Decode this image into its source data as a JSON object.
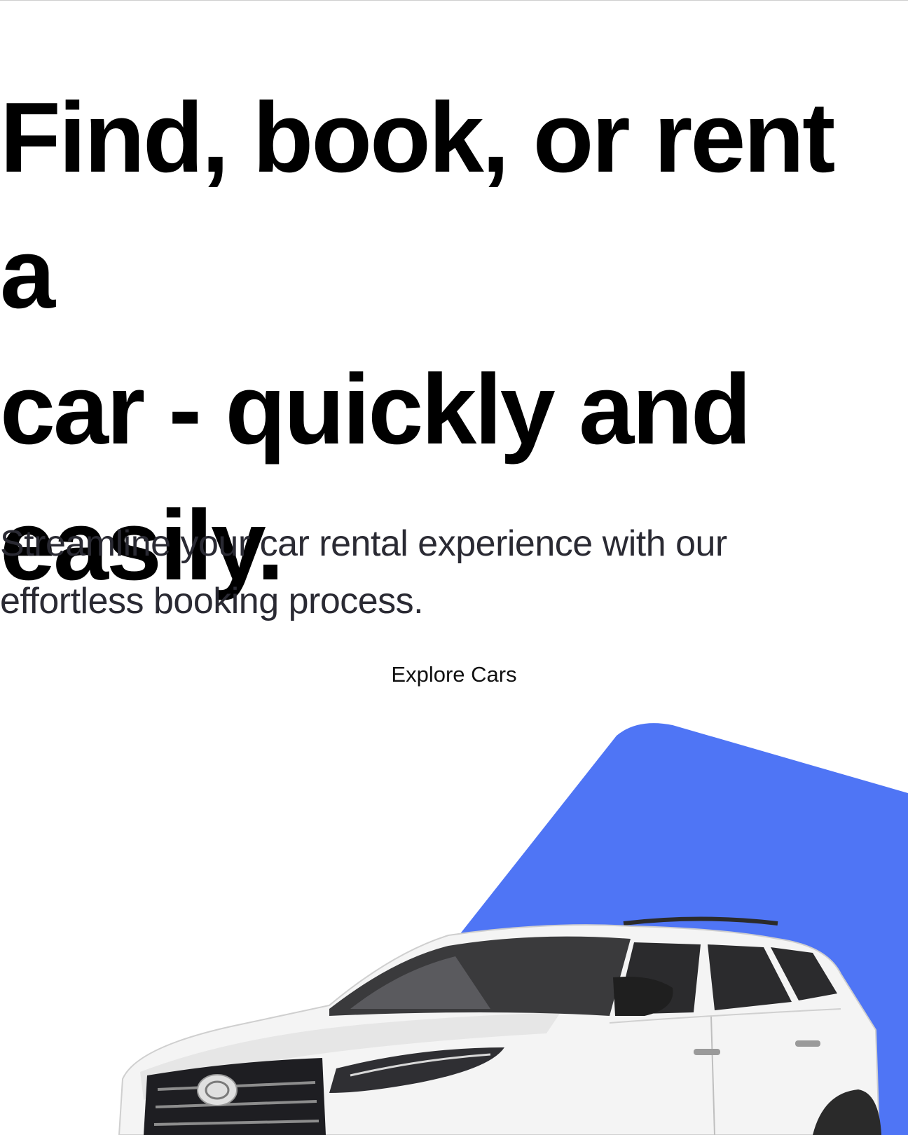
{
  "hero": {
    "title_line1": "Find, book, or rent a",
    "title_line2": "car - quickly and",
    "title_line3": "easily.",
    "subtitle_line1": "Streamline your car rental experience with our",
    "subtitle_line2": "effortless booking process.",
    "cta_label": "Explore Cars"
  },
  "colors": {
    "accent": "#4f75f5",
    "text": "#000000",
    "subtitle": "#2a2a33",
    "background": "#ffffff"
  },
  "visual": {
    "image": "white-suv-car",
    "shape": "blue-backdrop-shape"
  }
}
